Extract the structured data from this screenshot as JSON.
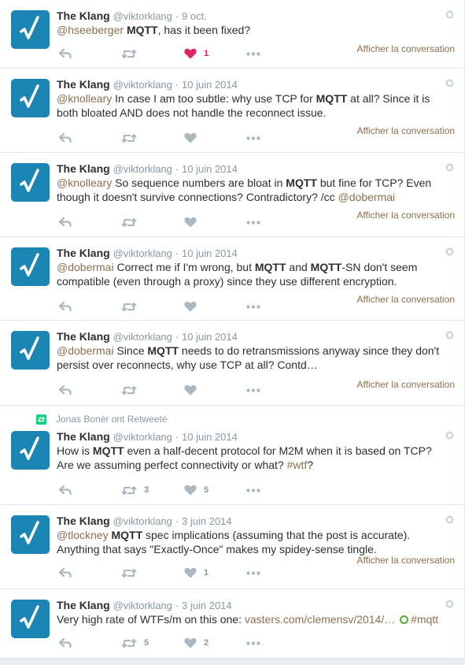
{
  "retweet_note": "Jonas Bonér ont Retweeté",
  "conversation_label": "Afficher la conversation",
  "colors": {
    "avatar": "#1b86b4",
    "link": "#8c6f4e",
    "liked": "#e0245e",
    "retweet_badge": "#19cf86"
  },
  "tweets": [
    {
      "name": "The Klang",
      "handle": "@viktorklang",
      "sep": "·",
      "date": "9 oct.",
      "parts": [
        "@hseeberger",
        " ",
        "MQTT",
        ", has it been fixed?"
      ],
      "retweets": "",
      "likes": "1",
      "liked": true,
      "conversation": true
    },
    {
      "name": "The Klang",
      "handle": "@viktorklang",
      "sep": "·",
      "date": "10 juin 2014",
      "parts": [
        "@knolleary",
        " In case I am too subtle: why use TCP for ",
        "MQTT",
        " at all? Since it is both bloated AND does not handle the reconnect issue."
      ],
      "retweets": "",
      "likes": "",
      "liked": false,
      "conversation": true
    },
    {
      "name": "The Klang",
      "handle": "@viktorklang",
      "sep": "·",
      "date": "10 juin 2014",
      "parts": [
        "@knolleary",
        " So sequence numbers are bloat in ",
        "MQTT",
        " but fine for TCP? Even though it doesn't survive connections? Contradictory? /cc ",
        "@dobermai"
      ],
      "retweets": "",
      "likes": "",
      "liked": false,
      "conversation": true
    },
    {
      "name": "The Klang",
      "handle": "@viktorklang",
      "sep": "·",
      "date": "10 juin 2014",
      "parts": [
        "@dobermai",
        " Correct me if I'm wrong, but ",
        "MQTT",
        " and ",
        "MQTT",
        "-SN don't seem compatible (even through a proxy) since they use different encryption."
      ],
      "retweets": "",
      "likes": "",
      "liked": false,
      "conversation": true
    },
    {
      "name": "The Klang",
      "handle": "@viktorklang",
      "sep": "·",
      "date": "10 juin 2014",
      "parts": [
        "@dobermai",
        " Since ",
        "MQTT",
        " needs to do retransmissions anyway since they don't persist over reconnects, why use TCP at all? Contd…"
      ],
      "retweets": "",
      "likes": "",
      "liked": false,
      "conversation": true
    },
    {
      "name": "The Klang",
      "handle": "@viktorklang",
      "sep": "·",
      "date": "10 juin 2014",
      "parts": [
        "How is ",
        "MQTT",
        " even a half-decent protocol for M2M when it is based on TCP? Are we assuming perfect connectivity or what? ",
        "#wtf",
        "?"
      ],
      "retweets": "3",
      "likes": "5",
      "liked": false,
      "conversation": false
    },
    {
      "name": "The Klang",
      "handle": "@viktorklang",
      "sep": "·",
      "date": "3 juin 2014",
      "parts": [
        "@tlockney",
        " ",
        "MQTT",
        " spec implications (assuming that the post is accurate). Anything that says \"Exactly-Once\" makes my spidey-sense tingle."
      ],
      "retweets": "",
      "likes": "1",
      "liked": false,
      "conversation": true
    },
    {
      "name": "The Klang",
      "handle": "@viktorklang",
      "sep": "·",
      "date": "3 juin 2014",
      "parts": [
        "Very high rate of WTFs/m on this one: ",
        "vasters.com/clemensv/2014/…",
        " ",
        "#mqtt"
      ],
      "retweets": "5",
      "likes": "2",
      "liked": false,
      "conversation": false
    }
  ]
}
